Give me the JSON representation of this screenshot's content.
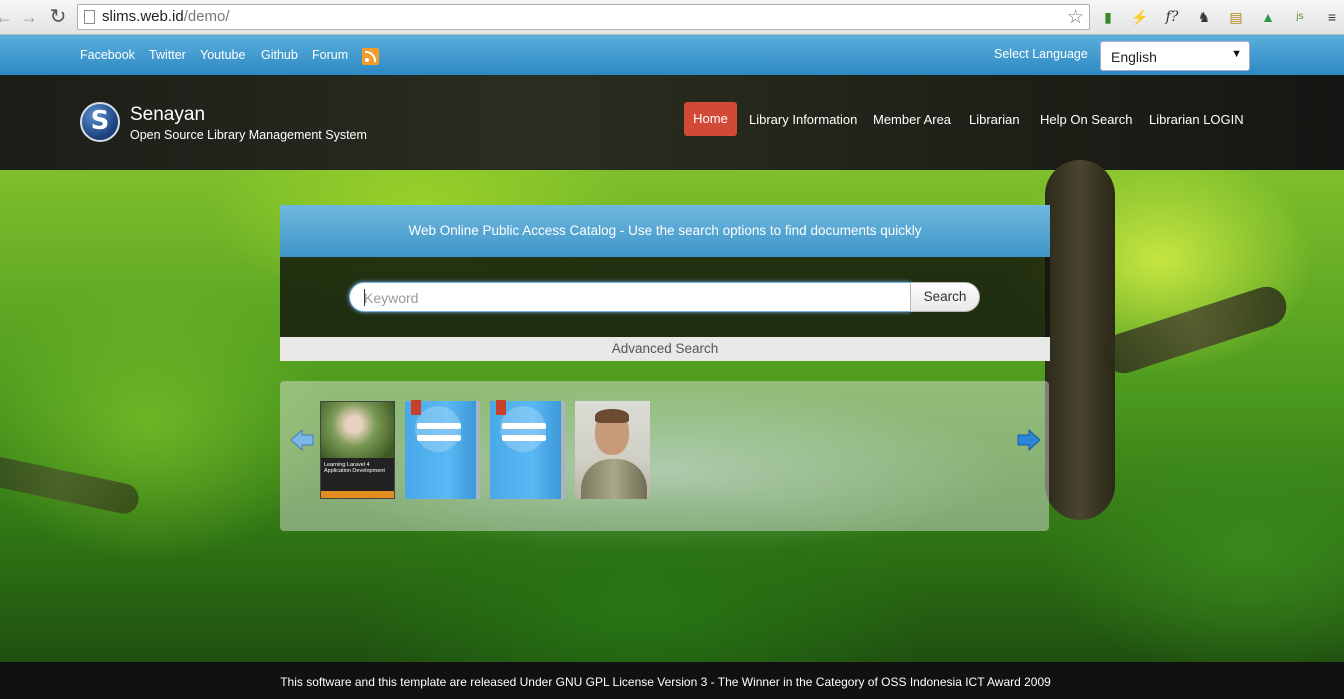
{
  "browser": {
    "url_host": "slims.web.id",
    "url_path": "/demo/"
  },
  "topbar": {
    "links": [
      "Facebook",
      "Twitter",
      "Youtube",
      "Github",
      "Forum"
    ],
    "language_label": "Select Language",
    "language_value": "English"
  },
  "header": {
    "site_name": "Senayan",
    "tagline": "Open Source Library Management System",
    "menu": [
      "Home",
      "Library Information",
      "Member Area",
      "Librarian",
      "Help On Search",
      "Librarian LOGIN"
    ]
  },
  "opac": {
    "title": "Web Online Public Access Catalog - Use the search options to find documents quickly",
    "search_placeholder": "Keyword",
    "search_button": "Search",
    "advanced_search": "Advanced Search"
  },
  "carousel": {
    "covers": [
      {
        "type": "book",
        "title": "Learning Laravel 4 Application Development"
      },
      {
        "type": "generic"
      },
      {
        "type": "generic"
      },
      {
        "type": "photo"
      }
    ]
  },
  "footer": {
    "text": "This software and this template are released Under GNU GPL License Version 3 - The Winner in the Category of OSS Indonesia ICT Award 2009"
  },
  "colors": {
    "topbar": "#3a97cc",
    "home_active": "#d14a35",
    "header_bg": "#1f2119",
    "footer_bg": "#111111"
  }
}
